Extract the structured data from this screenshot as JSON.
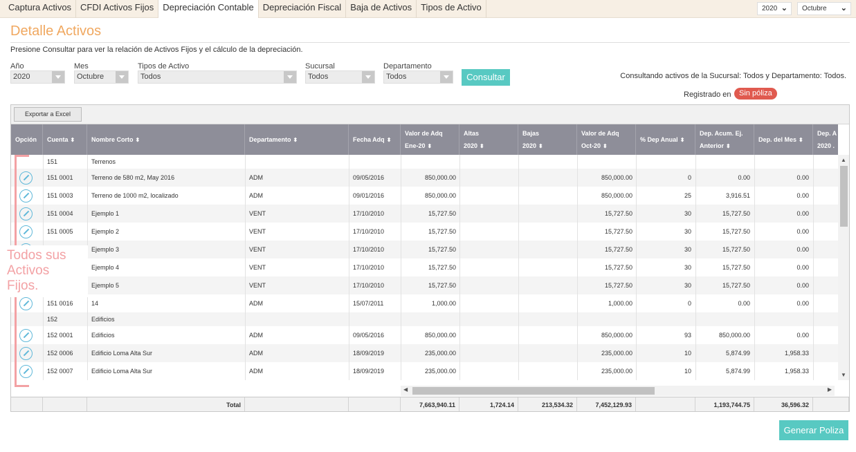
{
  "tabs": [
    "Captura Activos",
    "CFDI Activos Fijos",
    "Depreciación Contable",
    "Depreciación Fiscal",
    "Baja de Activos",
    "Tipos de Activo"
  ],
  "top_year": "2020",
  "top_month": "Octubre",
  "page_title": "Detalle Activos",
  "subtitle": "Presione Consultar para ver la relación de Activos Fijos y el cálculo de la depreciación.",
  "filters": {
    "anio_label": "Año",
    "anio_value": "2020",
    "mes_label": "Mes",
    "mes_value": "Octubre",
    "tipos_label": "Tipos de Activo",
    "tipos_value": "Todos",
    "sucursal_label": "Sucursal",
    "sucursal_value": "Todos",
    "depto_label": "Departamento",
    "depto_value": "Todos"
  },
  "consultar_label": "Consultar",
  "consultando_text": "Consultando activos de la Sucursal: Todos y Departamento: Todos.",
  "registrado_label": "Registrado en",
  "poliza_badge": "Sin póliza",
  "export_label": "Exportar a Excel",
  "columns": [
    {
      "l1": "Opción",
      "l2": ""
    },
    {
      "l1": "Cuenta",
      "l2": ""
    },
    {
      "l1": "Nombre Corto",
      "l2": ""
    },
    {
      "l1": "Departamento",
      "l2": ""
    },
    {
      "l1": "Fecha Adq",
      "l2": ""
    },
    {
      "l1": "Valor de Adq",
      "l2": "Ene-20"
    },
    {
      "l1": "Altas",
      "l2": "2020"
    },
    {
      "l1": "Bajas",
      "l2": "2020"
    },
    {
      "l1": "Valor de Adq",
      "l2": "Oct-20"
    },
    {
      "l1": "% Dep Anual",
      "l2": ""
    },
    {
      "l1": "Dep. Acum. Ej.",
      "l2": "Anterior"
    },
    {
      "l1": "Dep. del Mes",
      "l2": ""
    },
    {
      "l1": "Dep. A",
      "l2": "2020 ."
    }
  ],
  "rows": [
    {
      "group": true,
      "cuenta": "151",
      "nombre": "Terrenos",
      "depto": "",
      "fecha": "",
      "valor_ene": "",
      "altas": "",
      "bajas": "",
      "valor_oct": "",
      "pct": "",
      "dep_acum": "",
      "dep_mes": ""
    },
    {
      "cuenta": "151 0001",
      "nombre": "Terreno de 580 m2, May 2016",
      "depto": "ADM",
      "fecha": "09/05/2016",
      "valor_ene": "850,000.00",
      "altas": "",
      "bajas": "",
      "valor_oct": "850,000.00",
      "pct": "0",
      "dep_acum": "0.00",
      "dep_mes": "0.00"
    },
    {
      "cuenta": "151 0003",
      "nombre": "Terreno de 1000 m2, localizado",
      "depto": "ADM",
      "fecha": "09/01/2016",
      "valor_ene": "850,000.00",
      "altas": "",
      "bajas": "",
      "valor_oct": "850,000.00",
      "pct": "25",
      "dep_acum": "3,916.51",
      "dep_mes": "0.00"
    },
    {
      "cuenta": "151 0004",
      "nombre": "Ejemplo 1",
      "depto": "VENT",
      "fecha": "17/10/2010",
      "valor_ene": "15,727.50",
      "altas": "",
      "bajas": "",
      "valor_oct": "15,727.50",
      "pct": "30",
      "dep_acum": "15,727.50",
      "dep_mes": "0.00"
    },
    {
      "cuenta": "151 0005",
      "nombre": "Ejemplo 2",
      "depto": "VENT",
      "fecha": "17/10/2010",
      "valor_ene": "15,727.50",
      "altas": "",
      "bajas": "",
      "valor_oct": "15,727.50",
      "pct": "30",
      "dep_acum": "15,727.50",
      "dep_mes": "0.00"
    },
    {
      "cuenta": "",
      "nombre": "Ejemplo 3",
      "depto": "VENT",
      "fecha": "17/10/2010",
      "valor_ene": "15,727.50",
      "altas": "",
      "bajas": "",
      "valor_oct": "15,727.50",
      "pct": "30",
      "dep_acum": "15,727.50",
      "dep_mes": "0.00"
    },
    {
      "cuenta": "",
      "nombre": "Ejemplo 4",
      "depto": "VENT",
      "fecha": "17/10/2010",
      "valor_ene": "15,727.50",
      "altas": "",
      "bajas": "",
      "valor_oct": "15,727.50",
      "pct": "30",
      "dep_acum": "15,727.50",
      "dep_mes": "0.00"
    },
    {
      "cuenta": "",
      "nombre": "Ejemplo 5",
      "depto": "VENT",
      "fecha": "17/10/2010",
      "valor_ene": "15,727.50",
      "altas": "",
      "bajas": "",
      "valor_oct": "15,727.50",
      "pct": "30",
      "dep_acum": "15,727.50",
      "dep_mes": "0.00"
    },
    {
      "cuenta": "151 0016",
      "nombre": "14",
      "depto": "ADM",
      "fecha": "15/07/2011",
      "valor_ene": "1,000.00",
      "altas": "",
      "bajas": "",
      "valor_oct": "1,000.00",
      "pct": "0",
      "dep_acum": "0.00",
      "dep_mes": "0.00"
    },
    {
      "group": true,
      "cuenta": "152",
      "nombre": "Edificios",
      "depto": "",
      "fecha": "",
      "valor_ene": "",
      "altas": "",
      "bajas": "",
      "valor_oct": "",
      "pct": "",
      "dep_acum": "",
      "dep_mes": ""
    },
    {
      "cuenta": "152 0001",
      "nombre": "Edificios",
      "depto": "ADM",
      "fecha": "09/05/2016",
      "valor_ene": "850,000.00",
      "altas": "",
      "bajas": "",
      "valor_oct": "850,000.00",
      "pct": "93",
      "dep_acum": "850,000.00",
      "dep_mes": "0.00"
    },
    {
      "cuenta": "152 0006",
      "nombre": "Edificio Loma Alta Sur",
      "depto": "ADM",
      "fecha": "18/09/2019",
      "valor_ene": "235,000.00",
      "altas": "",
      "bajas": "",
      "valor_oct": "235,000.00",
      "pct": "10",
      "dep_acum": "5,874.99",
      "dep_mes": "1,958.33"
    },
    {
      "cuenta": "152 0007",
      "nombre": "Edificio Loma Alta Sur",
      "depto": "ADM",
      "fecha": "18/09/2019",
      "valor_ene": "235,000.00",
      "altas": "",
      "bajas": "",
      "valor_oct": "235,000.00",
      "pct": "10",
      "dep_acum": "5,874.99",
      "dep_mes": "1,958.33"
    }
  ],
  "totals": {
    "label": "Total",
    "valor_ene": "7,663,940.11",
    "altas": "1,724.14",
    "bajas": "213,534.32",
    "valor_oct": "7,452,129.93",
    "dep_acum": "1,193,744.75",
    "dep_mes": "36,596.32"
  },
  "annotation": "Todos sus Activos Fijos.",
  "generar_label": "Generar Poliza"
}
